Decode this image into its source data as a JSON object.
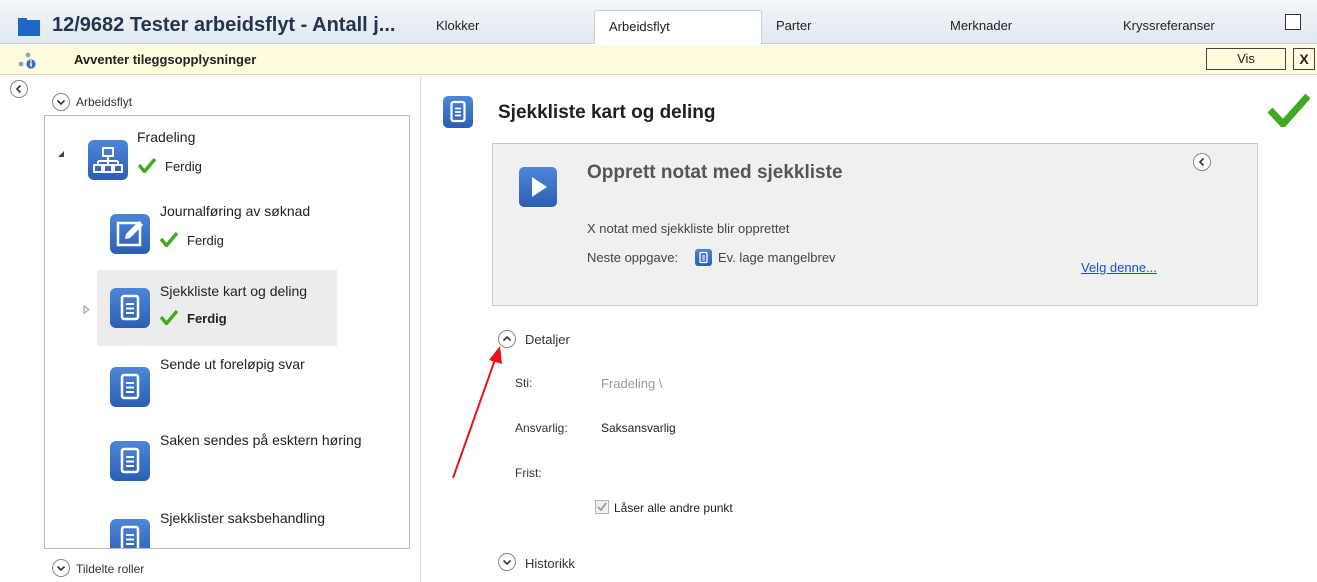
{
  "window": {
    "title": "12/9682 Tester arbeidsflyt - Antall j...",
    "tabs": [
      "Klokker",
      "Arbeidsflyt",
      "Parter",
      "Merknader",
      "Kryssreferanser"
    ],
    "active_tab": "Arbeidsflyt"
  },
  "banner": {
    "text": "Avventer tileggsopplysninger",
    "vis_label": "Vis",
    "close_label": "X"
  },
  "left": {
    "section_label": "Arbeidsflyt",
    "footer_label": "Tildelte roller",
    "tree": [
      {
        "title": "Fradeling",
        "status": "Ferdig",
        "icon": "hierarchy-icon"
      },
      {
        "title": "Journalføring av søknad",
        "status": "Ferdig",
        "icon": "edit-icon"
      },
      {
        "title": "Sjekkliste kart og deling",
        "status": "Ferdig",
        "icon": "document-icon"
      },
      {
        "title": "Sende ut foreløpig svar",
        "status": "",
        "icon": "document-icon"
      },
      {
        "title": "Saken sendes på esktern høring",
        "status": "",
        "icon": "document-icon"
      },
      {
        "title": "Sjekklister saksbehandling",
        "status": "",
        "icon": "document-icon"
      }
    ]
  },
  "main": {
    "title": "Sjekkliste kart og deling",
    "card": {
      "title": "Opprett notat med sjekkliste",
      "description": "X notat med sjekkliste blir opprettet",
      "next_label": "Neste oppgave:",
      "next_task": "Ev. lage mangelbrev",
      "link": "Velg denne..."
    },
    "details": {
      "label": "Detaljer",
      "sti_label": "Sti:",
      "sti_value": "Fradeling  \\",
      "ansvarlig_label": "Ansvarlig:",
      "ansvarlig_value": "Saksansvarlig",
      "frist_label": "Frist:",
      "lock_label": "Låser alle andre punkt"
    },
    "history_label": "Historikk"
  },
  "colors": {
    "accent": "#2c5fb4",
    "check": "#3faa1f",
    "link": "#1a4fd6",
    "annotation_arrow": "#e8141a"
  }
}
